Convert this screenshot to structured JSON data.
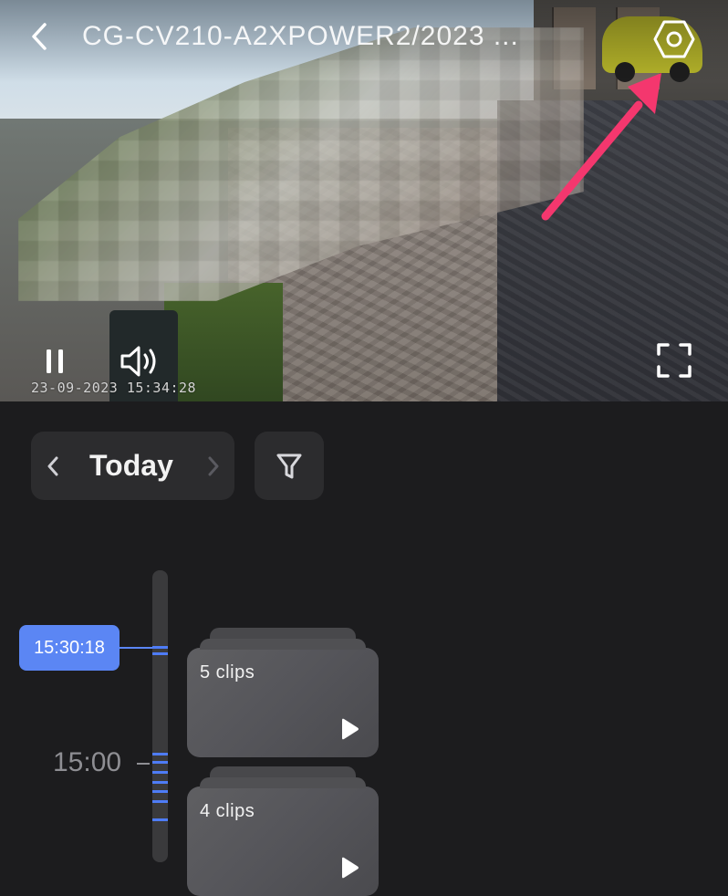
{
  "header": {
    "title": "CG-CV210-A2XPOWER2/2023 ...",
    "back_icon": "chevron-left-icon",
    "settings_icon": "gear-hexagon-icon"
  },
  "video": {
    "timestamp": "23-09-2023 15:34:28",
    "pause_icon": "pause-icon",
    "volume_icon": "speaker-icon",
    "fullscreen_icon": "fullscreen-icon"
  },
  "date_nav": {
    "label": "Today",
    "prev_icon": "chevron-left-icon",
    "next_icon": "chevron-right-icon"
  },
  "filter": {
    "icon": "filter-icon"
  },
  "timeline": {
    "current_time": "15:30:18",
    "hour_label": "15:00"
  },
  "clips": [
    {
      "label": "5 clips",
      "play_icon": "play-icon"
    },
    {
      "label": "4 clips",
      "play_icon": "play-icon"
    }
  ],
  "colors": {
    "accent": "#5b86f4",
    "annotation_arrow": "#f4376e",
    "background": "#1c1c1e",
    "card": "#2c2c2e"
  }
}
